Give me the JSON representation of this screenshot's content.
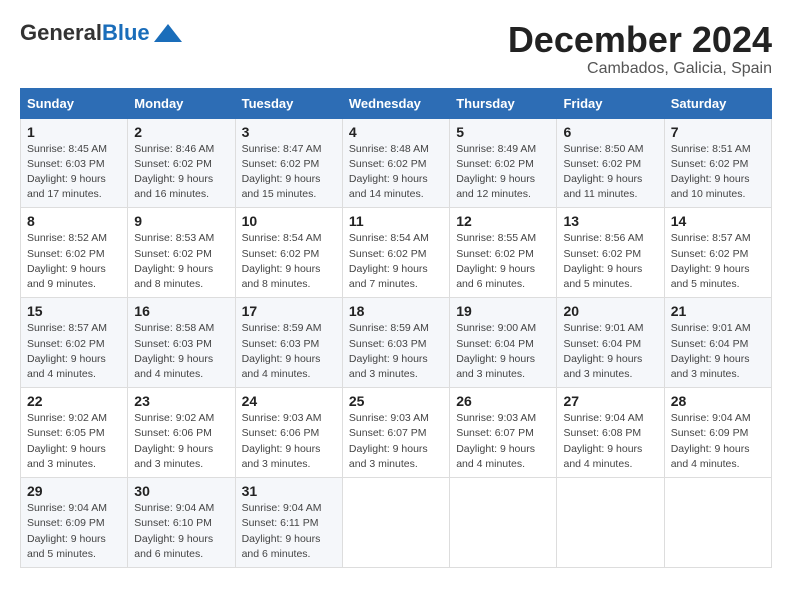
{
  "logo": {
    "general": "General",
    "blue": "Blue"
  },
  "title": {
    "month": "December 2024",
    "location": "Cambados, Galicia, Spain"
  },
  "headers": [
    "Sunday",
    "Monday",
    "Tuesday",
    "Wednesday",
    "Thursday",
    "Friday",
    "Saturday"
  ],
  "weeks": [
    [
      {
        "day": "1",
        "sunrise": "8:45 AM",
        "sunset": "6:03 PM",
        "daylight": "9 hours and 17 minutes."
      },
      {
        "day": "2",
        "sunrise": "8:46 AM",
        "sunset": "6:02 PM",
        "daylight": "9 hours and 16 minutes."
      },
      {
        "day": "3",
        "sunrise": "8:47 AM",
        "sunset": "6:02 PM",
        "daylight": "9 hours and 15 minutes."
      },
      {
        "day": "4",
        "sunrise": "8:48 AM",
        "sunset": "6:02 PM",
        "daylight": "9 hours and 14 minutes."
      },
      {
        "day": "5",
        "sunrise": "8:49 AM",
        "sunset": "6:02 PM",
        "daylight": "9 hours and 12 minutes."
      },
      {
        "day": "6",
        "sunrise": "8:50 AM",
        "sunset": "6:02 PM",
        "daylight": "9 hours and 11 minutes."
      },
      {
        "day": "7",
        "sunrise": "8:51 AM",
        "sunset": "6:02 PM",
        "daylight": "9 hours and 10 minutes."
      }
    ],
    [
      {
        "day": "8",
        "sunrise": "8:52 AM",
        "sunset": "6:02 PM",
        "daylight": "9 hours and 9 minutes."
      },
      {
        "day": "9",
        "sunrise": "8:53 AM",
        "sunset": "6:02 PM",
        "daylight": "9 hours and 8 minutes."
      },
      {
        "day": "10",
        "sunrise": "8:54 AM",
        "sunset": "6:02 PM",
        "daylight": "9 hours and 8 minutes."
      },
      {
        "day": "11",
        "sunrise": "8:54 AM",
        "sunset": "6:02 PM",
        "daylight": "9 hours and 7 minutes."
      },
      {
        "day": "12",
        "sunrise": "8:55 AM",
        "sunset": "6:02 PM",
        "daylight": "9 hours and 6 minutes."
      },
      {
        "day": "13",
        "sunrise": "8:56 AM",
        "sunset": "6:02 PM",
        "daylight": "9 hours and 5 minutes."
      },
      {
        "day": "14",
        "sunrise": "8:57 AM",
        "sunset": "6:02 PM",
        "daylight": "9 hours and 5 minutes."
      }
    ],
    [
      {
        "day": "15",
        "sunrise": "8:57 AM",
        "sunset": "6:02 PM",
        "daylight": "9 hours and 4 minutes."
      },
      {
        "day": "16",
        "sunrise": "8:58 AM",
        "sunset": "6:03 PM",
        "daylight": "9 hours and 4 minutes."
      },
      {
        "day": "17",
        "sunrise": "8:59 AM",
        "sunset": "6:03 PM",
        "daylight": "9 hours and 4 minutes."
      },
      {
        "day": "18",
        "sunrise": "8:59 AM",
        "sunset": "6:03 PM",
        "daylight": "9 hours and 3 minutes."
      },
      {
        "day": "19",
        "sunrise": "9:00 AM",
        "sunset": "6:04 PM",
        "daylight": "9 hours and 3 minutes."
      },
      {
        "day": "20",
        "sunrise": "9:01 AM",
        "sunset": "6:04 PM",
        "daylight": "9 hours and 3 minutes."
      },
      {
        "day": "21",
        "sunrise": "9:01 AM",
        "sunset": "6:04 PM",
        "daylight": "9 hours and 3 minutes."
      }
    ],
    [
      {
        "day": "22",
        "sunrise": "9:02 AM",
        "sunset": "6:05 PM",
        "daylight": "9 hours and 3 minutes."
      },
      {
        "day": "23",
        "sunrise": "9:02 AM",
        "sunset": "6:06 PM",
        "daylight": "9 hours and 3 minutes."
      },
      {
        "day": "24",
        "sunrise": "9:03 AM",
        "sunset": "6:06 PM",
        "daylight": "9 hours and 3 minutes."
      },
      {
        "day": "25",
        "sunrise": "9:03 AM",
        "sunset": "6:07 PM",
        "daylight": "9 hours and 3 minutes."
      },
      {
        "day": "26",
        "sunrise": "9:03 AM",
        "sunset": "6:07 PM",
        "daylight": "9 hours and 4 minutes."
      },
      {
        "day": "27",
        "sunrise": "9:04 AM",
        "sunset": "6:08 PM",
        "daylight": "9 hours and 4 minutes."
      },
      {
        "day": "28",
        "sunrise": "9:04 AM",
        "sunset": "6:09 PM",
        "daylight": "9 hours and 4 minutes."
      }
    ],
    [
      {
        "day": "29",
        "sunrise": "9:04 AM",
        "sunset": "6:09 PM",
        "daylight": "9 hours and 5 minutes."
      },
      {
        "day": "30",
        "sunrise": "9:04 AM",
        "sunset": "6:10 PM",
        "daylight": "9 hours and 6 minutes."
      },
      {
        "day": "31",
        "sunrise": "9:04 AM",
        "sunset": "6:11 PM",
        "daylight": "9 hours and 6 minutes."
      },
      null,
      null,
      null,
      null
    ]
  ],
  "labels": {
    "sunrise": "Sunrise:",
    "sunset": "Sunset:",
    "daylight": "Daylight:"
  }
}
